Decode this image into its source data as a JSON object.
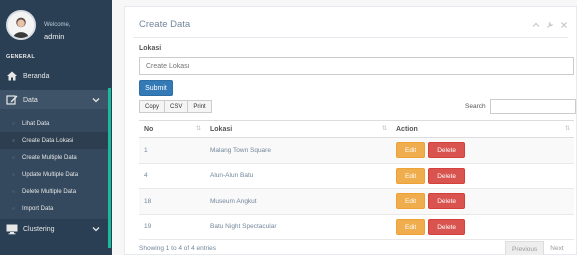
{
  "sidebar": {
    "welcome": "Welcome,",
    "username": "admin",
    "section": "GENERAL",
    "menu": {
      "beranda": "Beranda",
      "data": "Data",
      "clustering": "Clustering"
    },
    "submenu": [
      "Lihat Data",
      "Create Data Lokasi",
      "Create Multiple Data",
      "Update Multiple Data",
      "Delete Multiple Data",
      "Import Data"
    ]
  },
  "panel": {
    "title": "Create Data",
    "form": {
      "label": "Lokasi",
      "placeholder": "Create Lokasi",
      "submit": "Submit"
    },
    "dt_buttons": [
      "Copy",
      "CSV",
      "Print"
    ],
    "search_label": "Search",
    "table": {
      "headers": [
        "No",
        "Lokasi",
        "Action"
      ],
      "rows": [
        {
          "no": "1",
          "lokasi": "Malang Town Square"
        },
        {
          "no": "4",
          "lokasi": "Alun-Alun Batu"
        },
        {
          "no": "18",
          "lokasi": "Museum Angkut"
        },
        {
          "no": "19",
          "lokasi": "Batu Night Spectacular"
        }
      ],
      "edit_label": "Edit",
      "delete_label": "Delete"
    },
    "info": "Showing 1 to 4 of 4 entries",
    "pagination": {
      "previous": "Previous",
      "next": "Next"
    }
  },
  "colors": {
    "sidebar": "#2a3f54",
    "accent": "#1abb9c",
    "primary": "#337ab7",
    "warning": "#f0ad4e",
    "danger": "#d9534f"
  }
}
